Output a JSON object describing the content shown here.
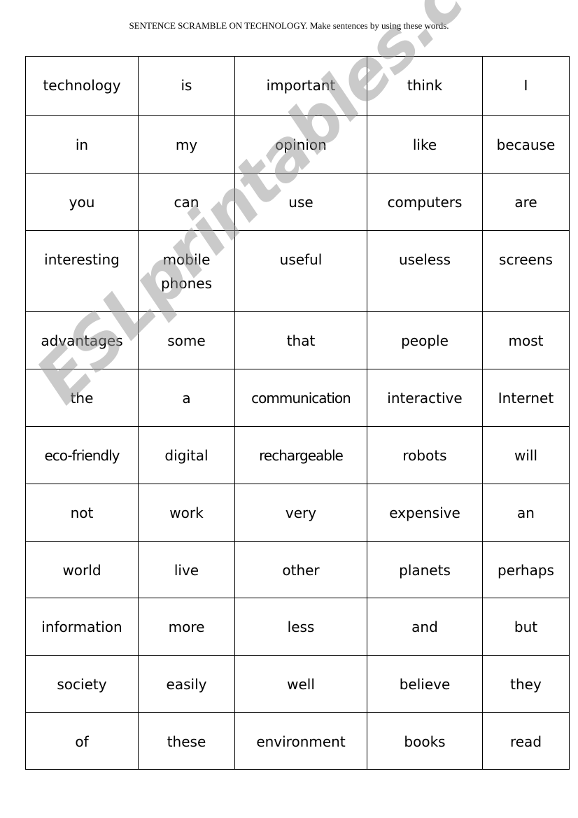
{
  "worksheet": {
    "title": "SENTENCE SCRAMBLE ON TECHNOLOGY. Make sentences by using these words.",
    "watermark": "ESLprintables.com",
    "rows": [
      [
        "technology",
        "is",
        "important",
        "think",
        "I"
      ],
      [
        "in",
        "my",
        "opinion",
        "like",
        "because"
      ],
      [
        "you",
        "can",
        "use",
        "computers",
        "are"
      ],
      [
        "interesting",
        "mobile phones",
        "useful",
        "useless",
        "screens"
      ],
      [
        "advantages",
        "some",
        "that",
        "people",
        "most"
      ],
      [
        "the",
        "a",
        "communication",
        "interactive",
        "Internet"
      ],
      [
        "eco-friendly",
        "digital",
        "rechargeable",
        "robots",
        "will"
      ],
      [
        "not",
        "work",
        "very",
        "expensive",
        "an"
      ],
      [
        "world",
        "live",
        "other",
        "planets",
        "perhaps"
      ],
      [
        "information",
        "more",
        "less",
        "and",
        "but"
      ],
      [
        "society",
        "easily",
        "well",
        "believe",
        "they"
      ],
      [
        "of",
        "these",
        "environment",
        "books",
        "read"
      ]
    ]
  }
}
